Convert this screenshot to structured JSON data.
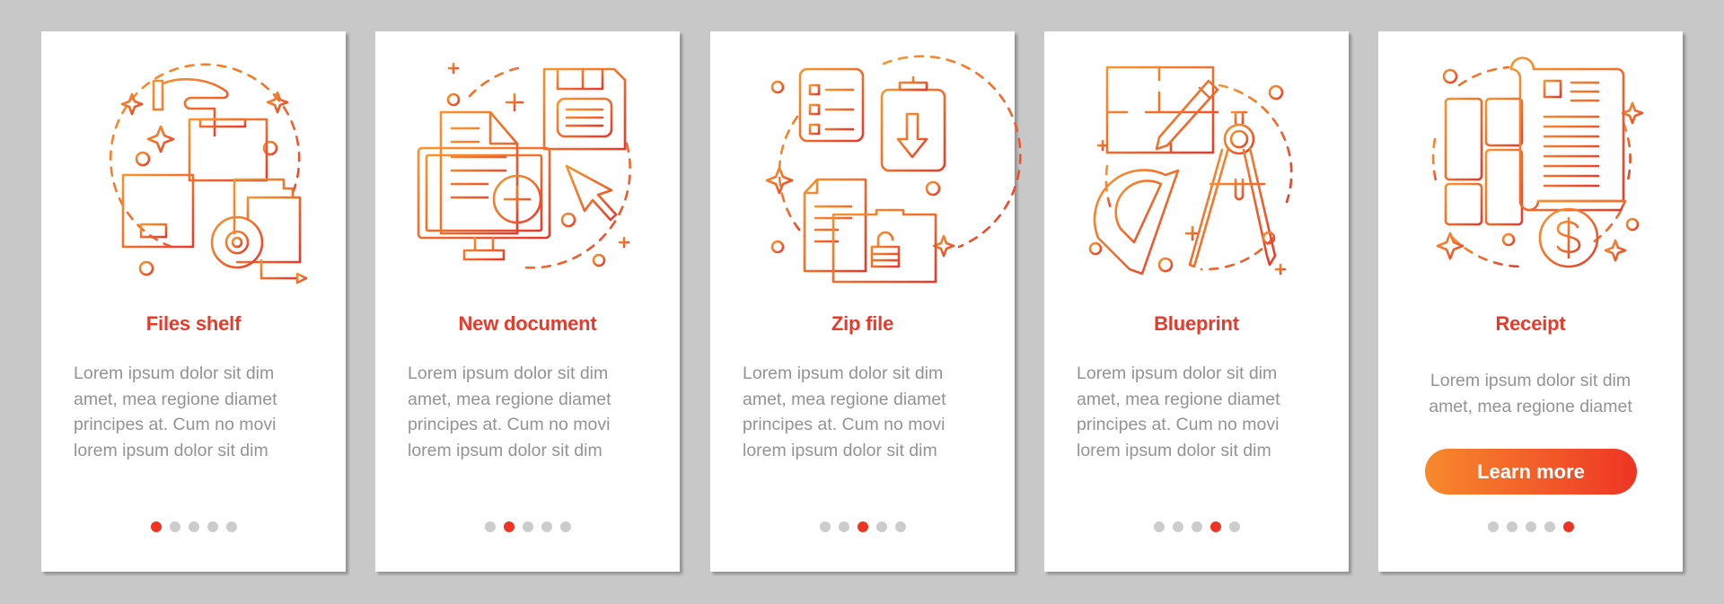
{
  "colors": {
    "background": "#c8c8c8",
    "title": "#e8392b",
    "body_text": "#939393",
    "dot_inactive": "#cccccc",
    "dot_active": "#ee3524",
    "icon_gradient_start": "#f7892b",
    "icon_gradient_end": "#e8392b"
  },
  "cards": [
    {
      "title": "Files shelf",
      "icon": "files-shelf-icon",
      "description": "Lorem ipsum dolor sit dim\namet, mea regione diamet\nprincipes at. Cum no movi\nlorem ipsum dolor sit dim",
      "active_page": 1,
      "total_pages": 5
    },
    {
      "title": "New document",
      "icon": "new-document-icon",
      "description": "Lorem ipsum dolor sit dim\namet, mea regione diamet\nprincipes at. Cum no movi\nlorem ipsum dolor sit dim",
      "active_page": 2,
      "total_pages": 5
    },
    {
      "title": "Zip file",
      "icon": "zip-file-icon",
      "description": "Lorem ipsum dolor sit dim\namet, mea regione diamet\nprincipes at. Cum no movi\nlorem ipsum dolor sit dim",
      "active_page": 3,
      "total_pages": 5
    },
    {
      "title": "Blueprint",
      "icon": "blueprint-icon",
      "description": "Lorem ipsum dolor sit dim\namet, mea regione diamet\nprincipes at. Cum no movi\nlorem ipsum dolor sit dim",
      "active_page": 4,
      "total_pages": 5
    },
    {
      "title": "Receipt",
      "icon": "receipt-icon",
      "description": "Lorem ipsum dolor sit dim\namet, mea regione diamet",
      "button_label": "Learn more",
      "active_page": 5,
      "total_pages": 5
    }
  ]
}
